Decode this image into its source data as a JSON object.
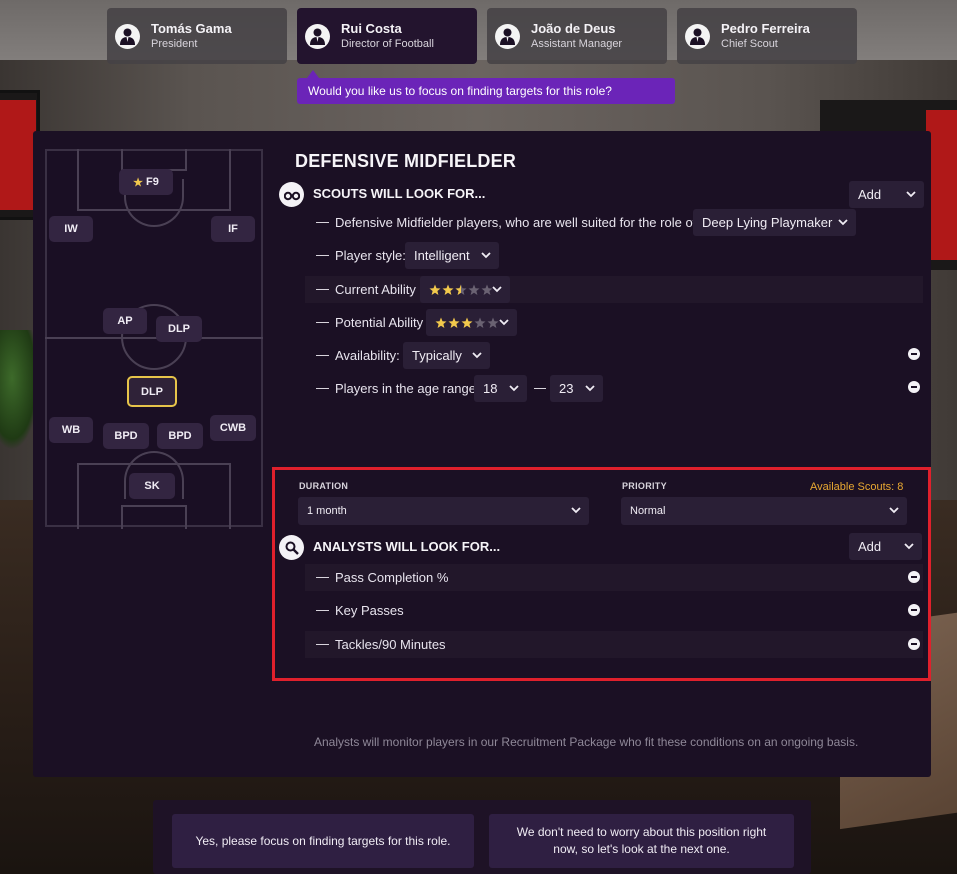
{
  "staff": [
    {
      "name": "Tomás Gama",
      "role": "President"
    },
    {
      "name": "Rui Costa",
      "role": "Director of Football"
    },
    {
      "name": "João de Deus",
      "role": "Assistant Manager"
    },
    {
      "name": "Pedro Ferreira",
      "role": "Chief Scout"
    }
  ],
  "question": "Would you like us to focus on finding targets for this role?",
  "pitch_positions": {
    "f9": "F9",
    "iw": "IW",
    "if": "IF",
    "ap": "AP",
    "dlp_top": "DLP",
    "dlp_selected": "DLP",
    "wb": "WB",
    "bpd_left": "BPD",
    "bpd_right": "BPD",
    "cwb": "CWB",
    "sk": "SK"
  },
  "role_title": "DEFENSIVE MIDFIELDER",
  "scouts": {
    "heading": "SCOUTS WILL LOOK FOR...",
    "add_label": "Add",
    "role_prefix": "Defensive Midfielder players, who are well suited for the role of:",
    "role_value": "Deep Lying Playmaker",
    "style_label": "Player style:",
    "style_value": "Intelligent",
    "ca_label": "Current Ability",
    "ca_stars": 2.5,
    "pa_label": "Potential Ability",
    "pa_stars": 3,
    "availability_label": "Availability:",
    "availability_value": "Typically",
    "age_label": "Players in the age range",
    "age_min": "18",
    "age_max": "23"
  },
  "duration": {
    "label": "DURATION",
    "value": "1 month"
  },
  "priority": {
    "label": "PRIORITY",
    "value": "Normal"
  },
  "available_scouts": "Available Scouts: 8",
  "analysts": {
    "heading": "ANALYSTS WILL LOOK FOR...",
    "add_label": "Add",
    "items": [
      "Pass Completion %",
      "Key Passes",
      "Tackles/90 Minutes"
    ]
  },
  "footnote": "Analysts will monitor players in our Recruitment Package who fit these conditions on an ongoing basis.",
  "actions": {
    "yes": "Yes, please focus on finding targets for this role.",
    "no": "We don't need to worry about this position right now, so let's look at the next one."
  },
  "colors": {
    "accent": "#6b24b8",
    "panel": "#1b1024",
    "star": "#f2c94c",
    "highlight": "#e0202c",
    "selected_border": "#e6c44a"
  }
}
